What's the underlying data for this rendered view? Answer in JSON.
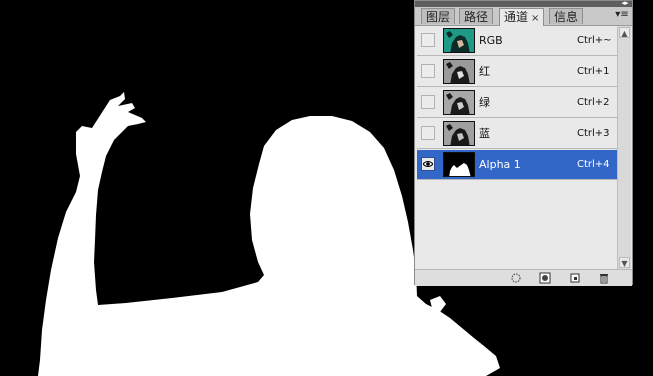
{
  "tabs": [
    {
      "label": "图层",
      "active": false
    },
    {
      "label": "路径",
      "active": false
    },
    {
      "label": "通道",
      "active": true,
      "close": "×"
    },
    {
      "label": "信息",
      "active": false
    }
  ],
  "panel_menu_icon": "▾≡",
  "collapse_icon": "◂▸",
  "channels": [
    {
      "name": "RGB",
      "shortcut": "Ctrl+~",
      "visible": false,
      "selected": false,
      "thumb": "color"
    },
    {
      "name": "红",
      "shortcut": "Ctrl+1",
      "visible": false,
      "selected": false,
      "thumb": "gray"
    },
    {
      "name": "绿",
      "shortcut": "Ctrl+2",
      "visible": false,
      "selected": false,
      "thumb": "gray"
    },
    {
      "name": "蓝",
      "shortcut": "Ctrl+3",
      "visible": false,
      "selected": false,
      "thumb": "gray"
    },
    {
      "name": "Alpha 1",
      "shortcut": "Ctrl+4",
      "visible": true,
      "selected": true,
      "thumb": "alpha"
    }
  ],
  "bottom_icons": [
    "load-selection-icon",
    "save-selection-icon",
    "new-channel-icon",
    "delete-channel-icon"
  ],
  "colors": {
    "selection": "#3267c8",
    "canvas_bg": "#000000",
    "mask": "#ffffff",
    "rgb_thumb": "#1e9a86"
  }
}
